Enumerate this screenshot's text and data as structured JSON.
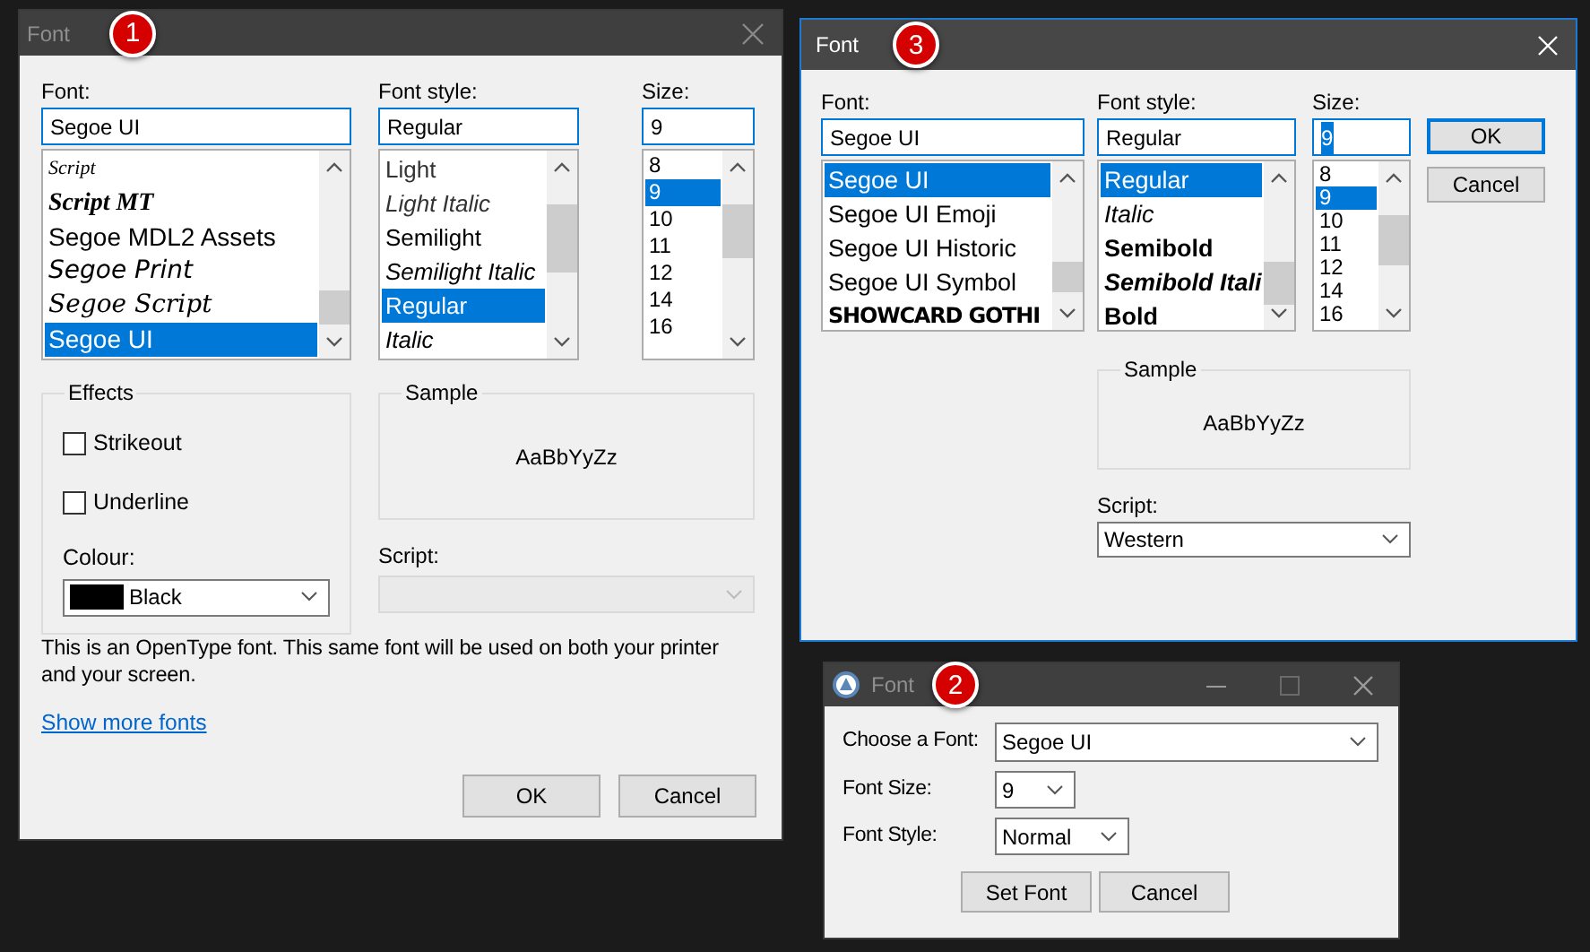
{
  "font_dialog_classic": {
    "title": "Font",
    "active": false,
    "badge": "1",
    "font": {
      "label": "Font:",
      "value": "Segoe UI",
      "items": [
        {
          "text": "Script",
          "kind": "script",
          "selected": false
        },
        {
          "text": "Script MT",
          "kind": "script_bold",
          "selected": false
        },
        {
          "text": "Segoe MDL2 Assets",
          "kind": "plain",
          "selected": false
        },
        {
          "text": "Segoe Print",
          "kind": "print",
          "selected": false
        },
        {
          "text": "Segoe Script",
          "kind": "cursive",
          "selected": false
        },
        {
          "text": "Segoe UI",
          "kind": "plain",
          "selected": true
        }
      ]
    },
    "style": {
      "label": "Font style:",
      "value": "Regular",
      "items": [
        {
          "text": "Light",
          "kind": "light",
          "selected": false
        },
        {
          "text": "Light Italic",
          "kind": "light_italic",
          "selected": false
        },
        {
          "text": "Semilight",
          "kind": "regular",
          "selected": false
        },
        {
          "text": "Semilight Italic",
          "kind": "italic",
          "selected": false
        },
        {
          "text": "Regular",
          "kind": "regular",
          "selected": true
        },
        {
          "text": "Italic",
          "kind": "italic",
          "selected": false
        }
      ]
    },
    "size": {
      "label": "Size:",
      "value": "9",
      "items": [
        {
          "text": "8",
          "selected": false
        },
        {
          "text": "9",
          "selected": true
        },
        {
          "text": "10",
          "selected": false
        },
        {
          "text": "11",
          "selected": false
        },
        {
          "text": "12",
          "selected": false
        },
        {
          "text": "14",
          "selected": false
        },
        {
          "text": "16",
          "selected": false
        }
      ]
    },
    "effects": {
      "legend": "Effects",
      "checkboxes": [
        {
          "label": "Strikeout",
          "checked": false
        },
        {
          "label": "Underline",
          "checked": false
        }
      ],
      "colour_label": "Colour:",
      "colour": {
        "value": "Black",
        "color": "#000000"
      }
    },
    "sample": {
      "legend": "Sample",
      "text": "AaBbYyZz"
    },
    "script": {
      "label": "Script:",
      "disabled": true
    },
    "description": "This is an OpenType font. This same font will be used on both your printer and your screen.",
    "link": "Show more fonts",
    "buttons": [
      "OK",
      "Cancel"
    ]
  },
  "font_dialog_compact": {
    "title": "Font",
    "active": true,
    "badge": "3",
    "font": {
      "label": "Font:",
      "value": "Segoe UI",
      "items": [
        {
          "text": "Segoe UI",
          "kind": "plain",
          "selected": true
        },
        {
          "text": "Segoe UI Emoji",
          "kind": "plain",
          "selected": false
        },
        {
          "text": "Segoe UI Historic",
          "kind": "plain",
          "selected": false
        },
        {
          "text": "Segoe UI Symbol",
          "kind": "plain",
          "selected": false
        },
        {
          "text": "SHOWCARD GOTHI",
          "kind": "display",
          "selected": false
        }
      ]
    },
    "style": {
      "label": "Font style:",
      "value": "Regular",
      "items": [
        {
          "text": "Regular",
          "kind": "regular",
          "selected": true
        },
        {
          "text": "Italic",
          "kind": "italic",
          "selected": false
        },
        {
          "text": "Semibold",
          "kind": "bold",
          "selected": false
        },
        {
          "text": "Semibold Itali",
          "kind": "bold_italic",
          "selected": false
        },
        {
          "text": "Bold",
          "kind": "bold",
          "selected": false
        }
      ]
    },
    "size": {
      "label": "Size:",
      "value": "9",
      "value_selected": true,
      "items": [
        {
          "text": "8",
          "selected": false
        },
        {
          "text": "9",
          "selected": true
        },
        {
          "text": "10",
          "selected": false
        },
        {
          "text": "11",
          "selected": false
        },
        {
          "text": "12",
          "selected": false
        },
        {
          "text": "14",
          "selected": false
        },
        {
          "text": "16",
          "selected": false
        }
      ]
    },
    "buttons": [
      {
        "label": "OK",
        "default": true
      },
      {
        "label": "Cancel",
        "default": false
      }
    ],
    "sample": {
      "legend": "Sample",
      "text": "AaBbYyZz"
    },
    "script": {
      "label": "Script:",
      "value": "Western",
      "disabled": false
    }
  },
  "font_dialog_app": {
    "title": "Font",
    "active": false,
    "badge": "2",
    "fields": [
      {
        "label": "Choose a Font:",
        "value": "Segoe UI"
      },
      {
        "label": "Font Size:",
        "value": "9"
      },
      {
        "label": "Font Style:",
        "value": "Normal"
      }
    ],
    "buttons": [
      "Set Font",
      "Cancel"
    ]
  }
}
